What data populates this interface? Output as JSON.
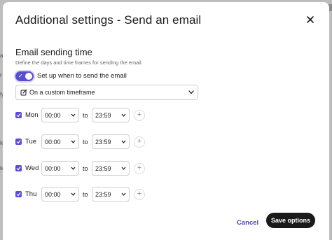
{
  "dialog": {
    "title": "Additional settings - Send an email",
    "section_title": "Email sending time",
    "section_description": "Define the days and time frames for sending the email.",
    "toggle": {
      "label": "Set up when to send the email",
      "enabled": true
    },
    "timeframe_select": {
      "selected": "On a custom timeframe"
    },
    "to_label": "to",
    "days": [
      {
        "day": "Mon",
        "checked": true,
        "from": "00:00",
        "to": "23:59"
      },
      {
        "day": "Tue",
        "checked": true,
        "from": "00:00",
        "to": "23:59"
      },
      {
        "day": "Wed",
        "checked": true,
        "from": "00:00",
        "to": "23:59"
      },
      {
        "day": "Thu",
        "checked": true,
        "from": "00:00",
        "to": "23:59"
      }
    ],
    "add_symbol": "+",
    "cancel_label": "Cancel",
    "save_label": "Save options"
  },
  "background": {
    "tab_fragment": "ta",
    "left_fragments": [
      "ag",
      "r",
      "fy",
      "le",
      "le"
    ]
  },
  "colors": {
    "accent": "#5b4fc9",
    "primary_button": "#1a1a1a",
    "cancel_text": "#4b44b8"
  }
}
